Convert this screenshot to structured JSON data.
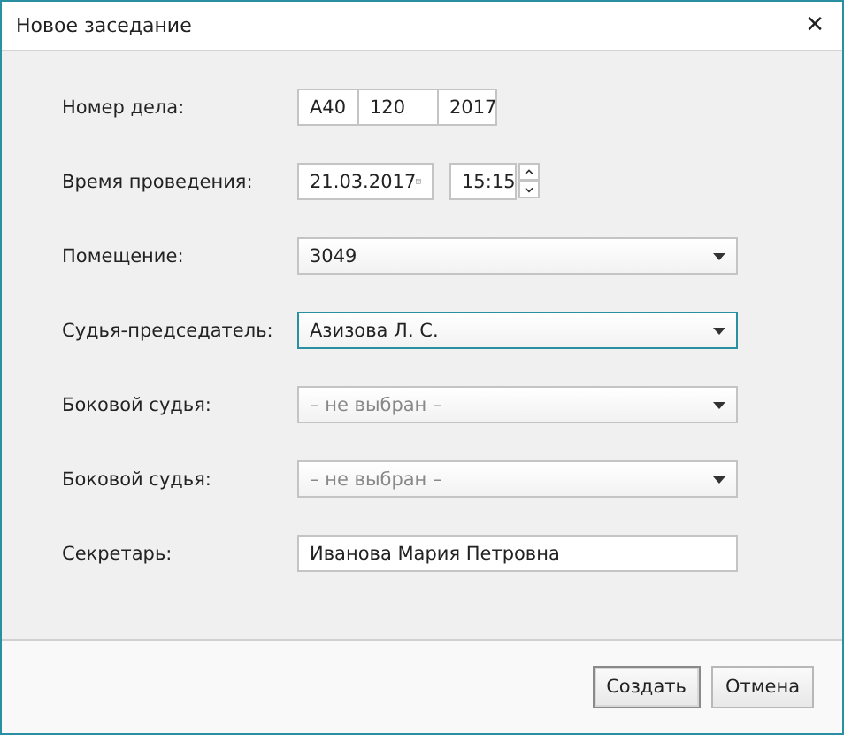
{
  "window": {
    "title": "Новое заседание",
    "close": "✕"
  },
  "fields": [
    {
      "kind": "case",
      "label": "Номер дела:",
      "parts": [
        "А40",
        "120",
        "2017"
      ]
    },
    {
      "kind": "datetime",
      "label": "Время проведения:",
      "date": "21.03.2017",
      "time": "15:15"
    },
    {
      "kind": "select",
      "label": "Помещение:",
      "value": "3049",
      "focused": false
    },
    {
      "kind": "select",
      "label": "Судья-председатель:",
      "value": "Азизова Л. С.",
      "focused": true
    },
    {
      "kind": "select",
      "label": "Боковой судья:",
      "placeholder": "– не выбран –",
      "focused": false
    },
    {
      "kind": "select",
      "label": "Боковой судья:",
      "placeholder": "– не выбран –",
      "focused": false
    },
    {
      "kind": "text",
      "label": "Секретарь:",
      "value": "Иванова Мария Петровна"
    }
  ],
  "buttons": [
    {
      "label": "Создать",
      "default": true
    },
    {
      "label": "Отмена",
      "default": false
    }
  ]
}
